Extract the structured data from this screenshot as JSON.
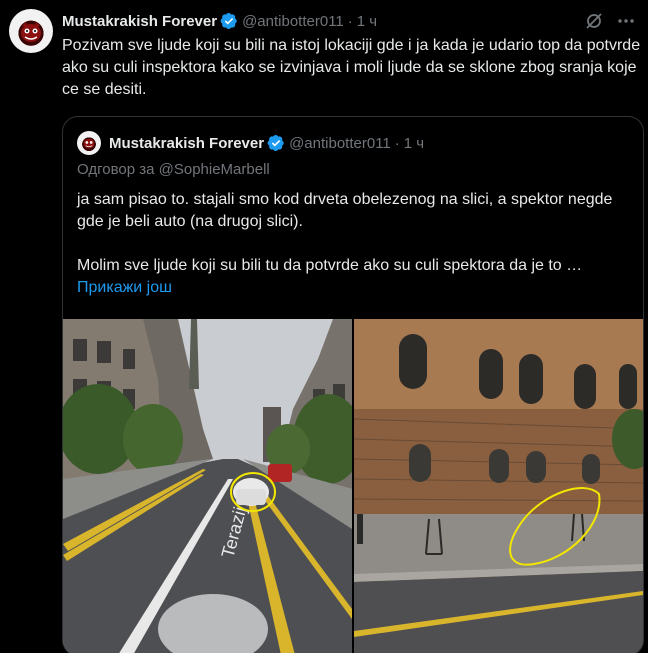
{
  "tweet": {
    "author_name": "Mustakrakish Forever",
    "handle": "@antibotter011",
    "separator": "·",
    "time": "1 ч",
    "text": "Pozivam sve ljude koji su bili na istoj lokaciji gde i ja kada je udario top da potvrde ako su culi inspektora kako se izvinjava i moli ljude da se sklone zbog sranja koje ce se desiti."
  },
  "quote": {
    "author_name": "Mustakrakish Forever",
    "handle": "@antibotter011",
    "separator": "·",
    "time": "1 ч",
    "reply_to": "Одговор за @SophieMarbell",
    "paragraph1": "ja sam pisao to. stajali smo kod drveta obelezenog na slici, a spektor negde gde je beli auto (na drugoj slici).",
    "paragraph2": "Molim sve ljude koji su bili tu da potvrde ako su culi spektora da je to …",
    "show_more": "Прикажи још"
  },
  "icons": [
    "verified-badge-icon",
    "grok-icon",
    "more-options-icon"
  ],
  "colors": {
    "background": "#000000",
    "text": "#e7e9ea",
    "muted": "#71767b",
    "link": "#1d9bf0",
    "border": "#2f3336",
    "annotation": "#f2e600"
  }
}
